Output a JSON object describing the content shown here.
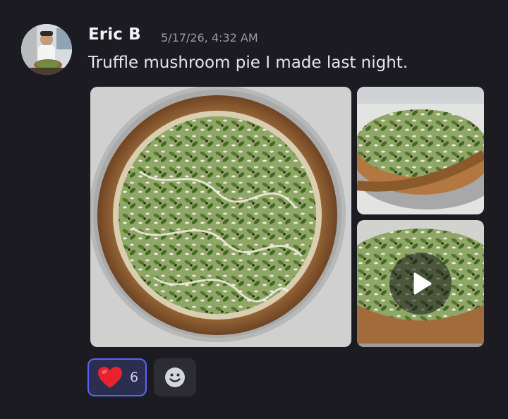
{
  "message": {
    "author": "Eric B",
    "timestamp": "5/17/26, 4:32 AM",
    "content": "Truffle mushroom pie I made last night.",
    "avatar_icon": "user-avatar-chef-holding-pizza"
  },
  "attachments": [
    {
      "kind": "image",
      "subject": "pizza-top-view"
    },
    {
      "kind": "image",
      "subject": "pizza-slice-side-view"
    },
    {
      "kind": "video",
      "subject": "pizza-closeup",
      "overlay_icon": "play-icon"
    }
  ],
  "reactions": [
    {
      "emoji_icon": "heart-icon",
      "count": "6",
      "reacted": true,
      "accent": "#5865f2"
    }
  ],
  "add_reaction_icon": "smiley-icon",
  "colors": {
    "background": "#1b1b21",
    "author": "#f2f3f5",
    "timestamp": "#9a9ca6",
    "reaction_border": "#5865f2"
  }
}
